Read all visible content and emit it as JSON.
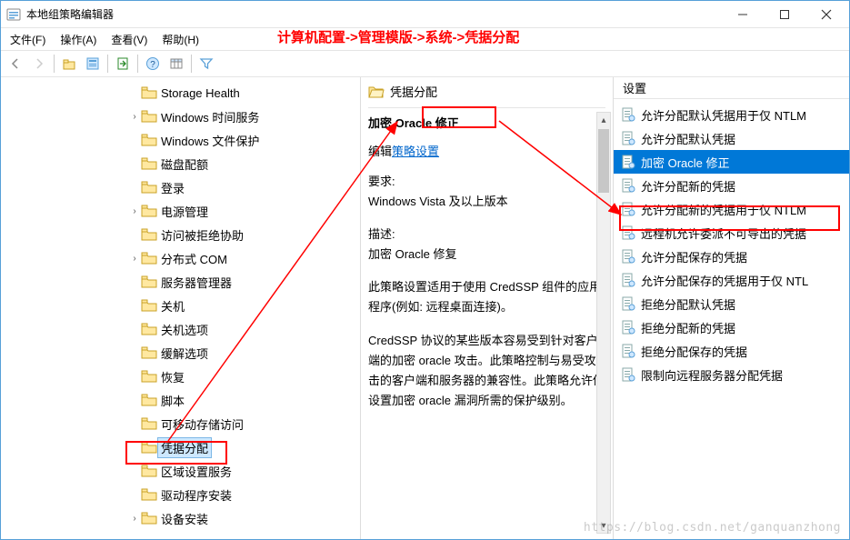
{
  "window": {
    "title": "本地组策略编辑器",
    "menu": {
      "file": "文件(F)",
      "action": "操作(A)",
      "view": "查看(V)",
      "help": "帮助(H)"
    }
  },
  "annotation": {
    "path_text": "计算机配置->管理模版->系统->凭据分配",
    "watermark": "https://blog.csdn.net/ganquanzhong"
  },
  "tree": {
    "items": [
      {
        "label": "Storage Health",
        "indent": 140,
        "expander": ""
      },
      {
        "label": "Windows 时间服务",
        "indent": 140,
        "expander": "›"
      },
      {
        "label": "Windows 文件保护",
        "indent": 140,
        "expander": ""
      },
      {
        "label": "磁盘配额",
        "indent": 140,
        "expander": ""
      },
      {
        "label": "登录",
        "indent": 140,
        "expander": ""
      },
      {
        "label": "电源管理",
        "indent": 140,
        "expander": "›"
      },
      {
        "label": "访问被拒绝协助",
        "indent": 140,
        "expander": ""
      },
      {
        "label": "分布式 COM",
        "indent": 140,
        "expander": "›"
      },
      {
        "label": "服务器管理器",
        "indent": 140,
        "expander": ""
      },
      {
        "label": "关机",
        "indent": 140,
        "expander": ""
      },
      {
        "label": "关机选项",
        "indent": 140,
        "expander": ""
      },
      {
        "label": "缓解选项",
        "indent": 140,
        "expander": ""
      },
      {
        "label": "恢复",
        "indent": 140,
        "expander": ""
      },
      {
        "label": "脚本",
        "indent": 140,
        "expander": ""
      },
      {
        "label": "可移动存储访问",
        "indent": 140,
        "expander": ""
      },
      {
        "label": "凭据分配",
        "indent": 140,
        "expander": "",
        "selected": true
      },
      {
        "label": "区域设置服务",
        "indent": 140,
        "expander": ""
      },
      {
        "label": "驱动程序安装",
        "indent": 140,
        "expander": ""
      },
      {
        "label": "设备安装",
        "indent": 140,
        "expander": "›"
      }
    ]
  },
  "detail": {
    "header": "凭据分配",
    "subtitle": "加密 Oracle 修正",
    "edit_prefix": "编辑",
    "edit_link": "策略设置",
    "req_label": "要求:",
    "req_value": "Windows Vista 及以上版本",
    "desc_label": "描述:",
    "desc_value": "加密 Oracle 修复",
    "body1": "此策略设置适用于使用 CredSSP 组件的应用程序(例如: 远程桌面连接)。",
    "body2": "CredSSP 协议的某些版本容易受到针对客户端的加密 oracle 攻击。此策略控制与易受攻击的客户端和服务器的兼容性。此策略允许你设置加密 oracle 漏洞所需的保护级别。"
  },
  "list": {
    "header": "设置",
    "items": [
      {
        "label": "允许分配默认凭据用于仅 NTLM"
      },
      {
        "label": "允许分配默认凭据"
      },
      {
        "label": "加密 Oracle 修正",
        "selected": true
      },
      {
        "label": "允许分配新的凭据"
      },
      {
        "label": "允许分配新的凭据用于仅 NTLM"
      },
      {
        "label": "远程机允许委派不可导出的凭据"
      },
      {
        "label": "允许分配保存的凭据"
      },
      {
        "label": "允许分配保存的凭据用于仅 NTL"
      },
      {
        "label": "拒绝分配默认凭据"
      },
      {
        "label": "拒绝分配新的凭据"
      },
      {
        "label": "拒绝分配保存的凭据"
      },
      {
        "label": "限制向远程服务器分配凭据"
      }
    ]
  }
}
